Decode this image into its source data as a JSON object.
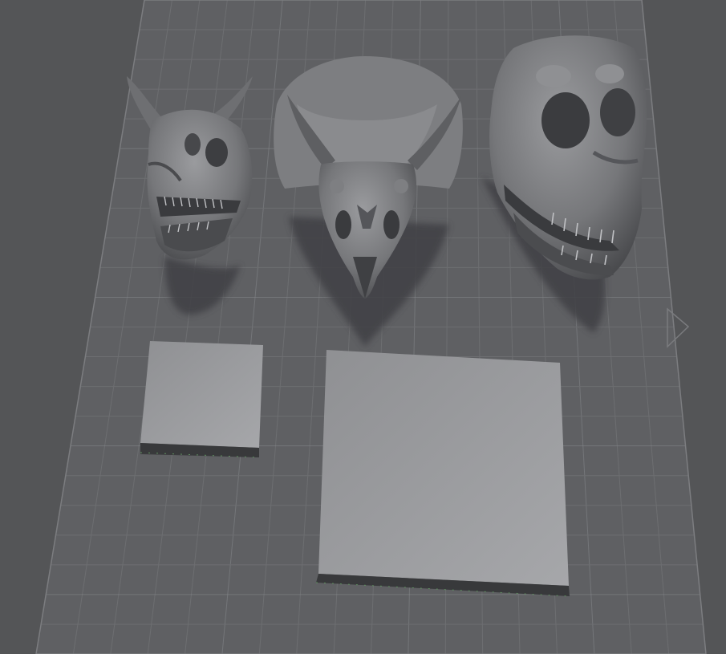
{
  "viewport": {
    "background": "#545557",
    "plate_color": "#606164",
    "grid_color": "#707174",
    "grid_major_color": "#8a8b8f"
  },
  "objects": [
    {
      "name": "carnotaurus-skull",
      "kind": "mesh",
      "icon": "horned-skull"
    },
    {
      "name": "triceratops-skull",
      "kind": "mesh",
      "icon": "frilled-skull"
    },
    {
      "name": "t-rex-skull",
      "kind": "mesh",
      "icon": "theropod-skull"
    },
    {
      "name": "small-base",
      "kind": "box"
    },
    {
      "name": "large-base",
      "kind": "box"
    }
  ],
  "colors": {
    "skull_light": "#8e8f92",
    "skull_mid": "#6c6d70",
    "skull_dark": "#3c3d40",
    "shadow": "#404144",
    "base_top": "#96979a",
    "base_side": "#3a3b3d"
  }
}
